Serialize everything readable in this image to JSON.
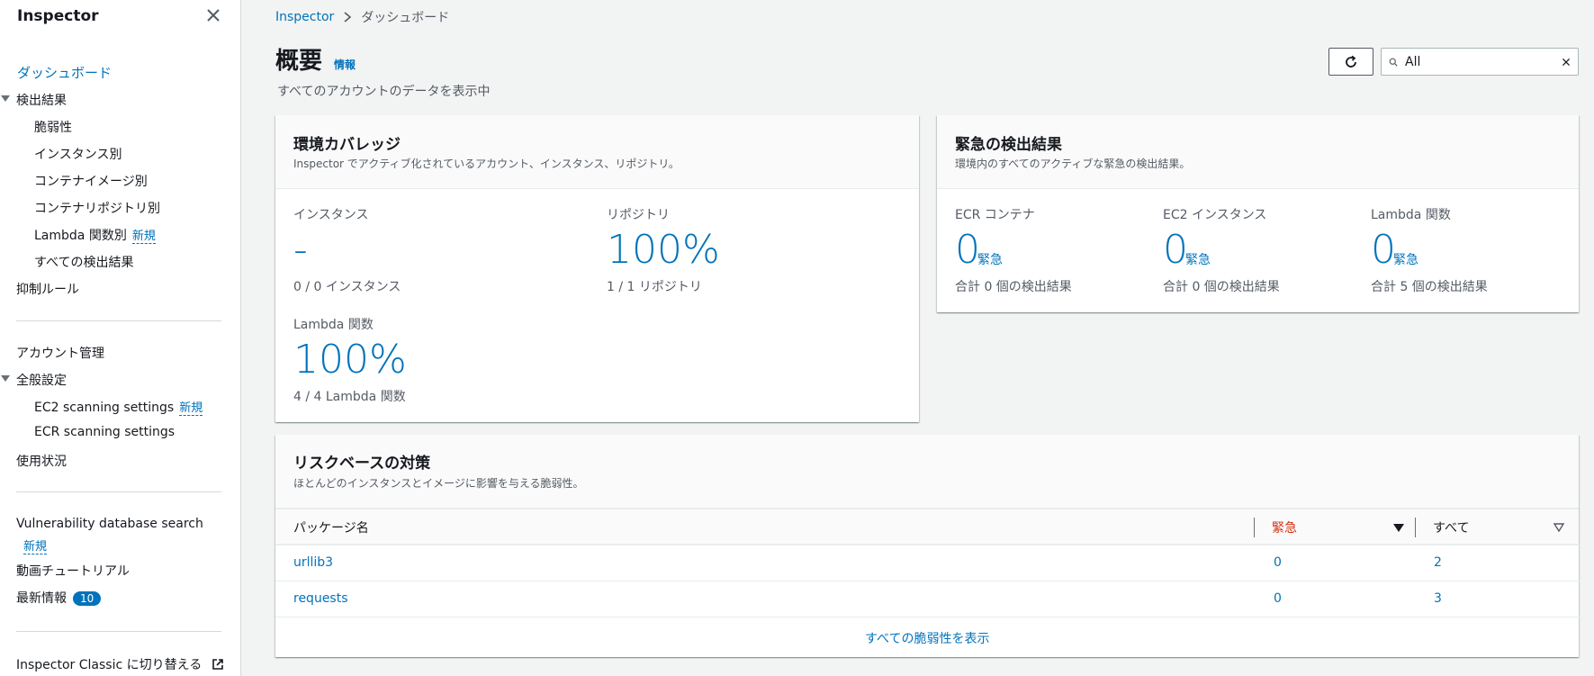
{
  "sidebar": {
    "title": "Inspector",
    "dashboard": "ダッシュボード",
    "findings_group": "検出結果",
    "findings": [
      "脆弱性",
      "インスタンス別",
      "コンテナイメージ別",
      "コンテナリポジトリ別",
      "Lambda 関数別",
      "すべての検出結果"
    ],
    "new_badge": "新規",
    "suppression": "抑制ルール",
    "account_mgmt": "アカウント管理",
    "general_settings": "全般設定",
    "ec2_scanning": "EC2 scanning settings",
    "ecr_scanning": "ECR scanning settings",
    "usage": "使用状況",
    "vuln_db_search": "Vulnerability database search",
    "video_tutorial": "動画チュートリアル",
    "whats_new": "最新情報",
    "whats_new_count": "10",
    "classic": "Inspector Classic に切り替える"
  },
  "breadcrumb": {
    "root": "Inspector",
    "current": "ダッシュボード"
  },
  "header": {
    "title": "概要",
    "info": "情報",
    "subtitle": "すべてのアカウントのデータを表示中",
    "search_value": "All"
  },
  "coverage": {
    "title": "環境カバレッジ",
    "desc": "Inspector でアクティブ化されているアカウント、インスタンス、リポジトリ。",
    "instances_label": "インスタンス",
    "instances_value": "-",
    "instances_sub": "0 / 0 インスタンス",
    "repos_label": "リポジトリ",
    "repos_value": "100%",
    "repos_sub": "1 / 1 リポジトリ",
    "lambda_label": "Lambda 関数",
    "lambda_value": "100%",
    "lambda_sub": "4 / 4 Lambda 関数"
  },
  "critical": {
    "title": "緊急の検出結果",
    "desc": "環境内のすべてのアクティブな緊急の検出結果。",
    "suffix": "緊急",
    "items": [
      {
        "label": "ECR コンテナ",
        "value": "0",
        "sub": "合計 0 個の検出結果"
      },
      {
        "label": "EC2 インスタンス",
        "value": "0",
        "sub": "合計 0 個の検出結果"
      },
      {
        "label": "Lambda 関数",
        "value": "0",
        "sub": "合計 5 個の検出結果"
      }
    ]
  },
  "risk": {
    "title": "リスクベースの対策",
    "desc": "ほとんどのインスタンスとイメージに影響を与える脆弱性。",
    "columns": {
      "package": "パッケージ名",
      "critical": "緊急",
      "all": "すべて"
    },
    "rows": [
      {
        "package": "urllib3",
        "critical": "0",
        "all": "2"
      },
      {
        "package": "requests",
        "critical": "0",
        "all": "3"
      }
    ],
    "view_all": "すべての脆弱性を表示"
  },
  "colors": {
    "accent": "#0073bb",
    "critical": "#d13212"
  }
}
